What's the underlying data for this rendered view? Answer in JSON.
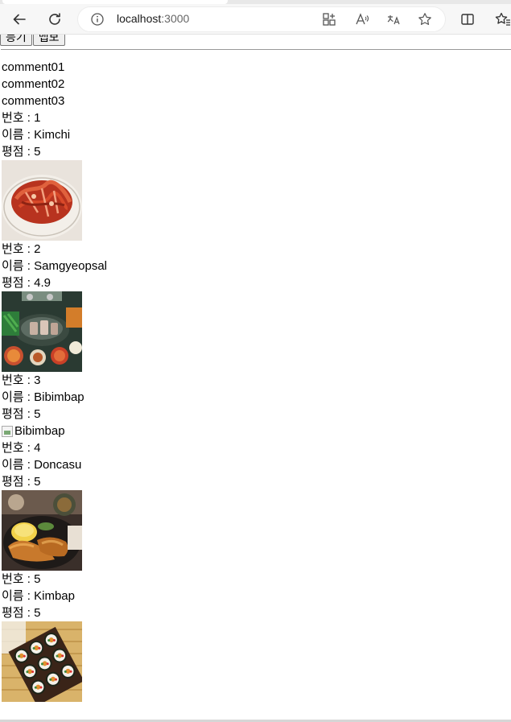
{
  "browser": {
    "url_host": "localhost",
    "url_port": ":3000"
  },
  "page": {
    "buttons": [
      "등기",
      "맵보"
    ],
    "comments": [
      "comment01",
      "comment02",
      "comment03"
    ],
    "labels": {
      "number": "번호 : ",
      "name": "이름 : ",
      "rating": "평점 : "
    },
    "foods": [
      {
        "id": "1",
        "name": "Kimchi",
        "rating": "5",
        "image": "kimchi"
      },
      {
        "id": "2",
        "name": "Samgyeopsal",
        "rating": "4.9",
        "image": "samgyeopsal"
      },
      {
        "id": "3",
        "name": "Bibimbap",
        "rating": "5",
        "image": "broken",
        "alt": "Bibimbap"
      },
      {
        "id": "4",
        "name": "Doncasu",
        "rating": "5",
        "image": "doncasu"
      },
      {
        "id": "5",
        "name": "Kimbap",
        "rating": "5",
        "image": "kimbap"
      }
    ]
  }
}
